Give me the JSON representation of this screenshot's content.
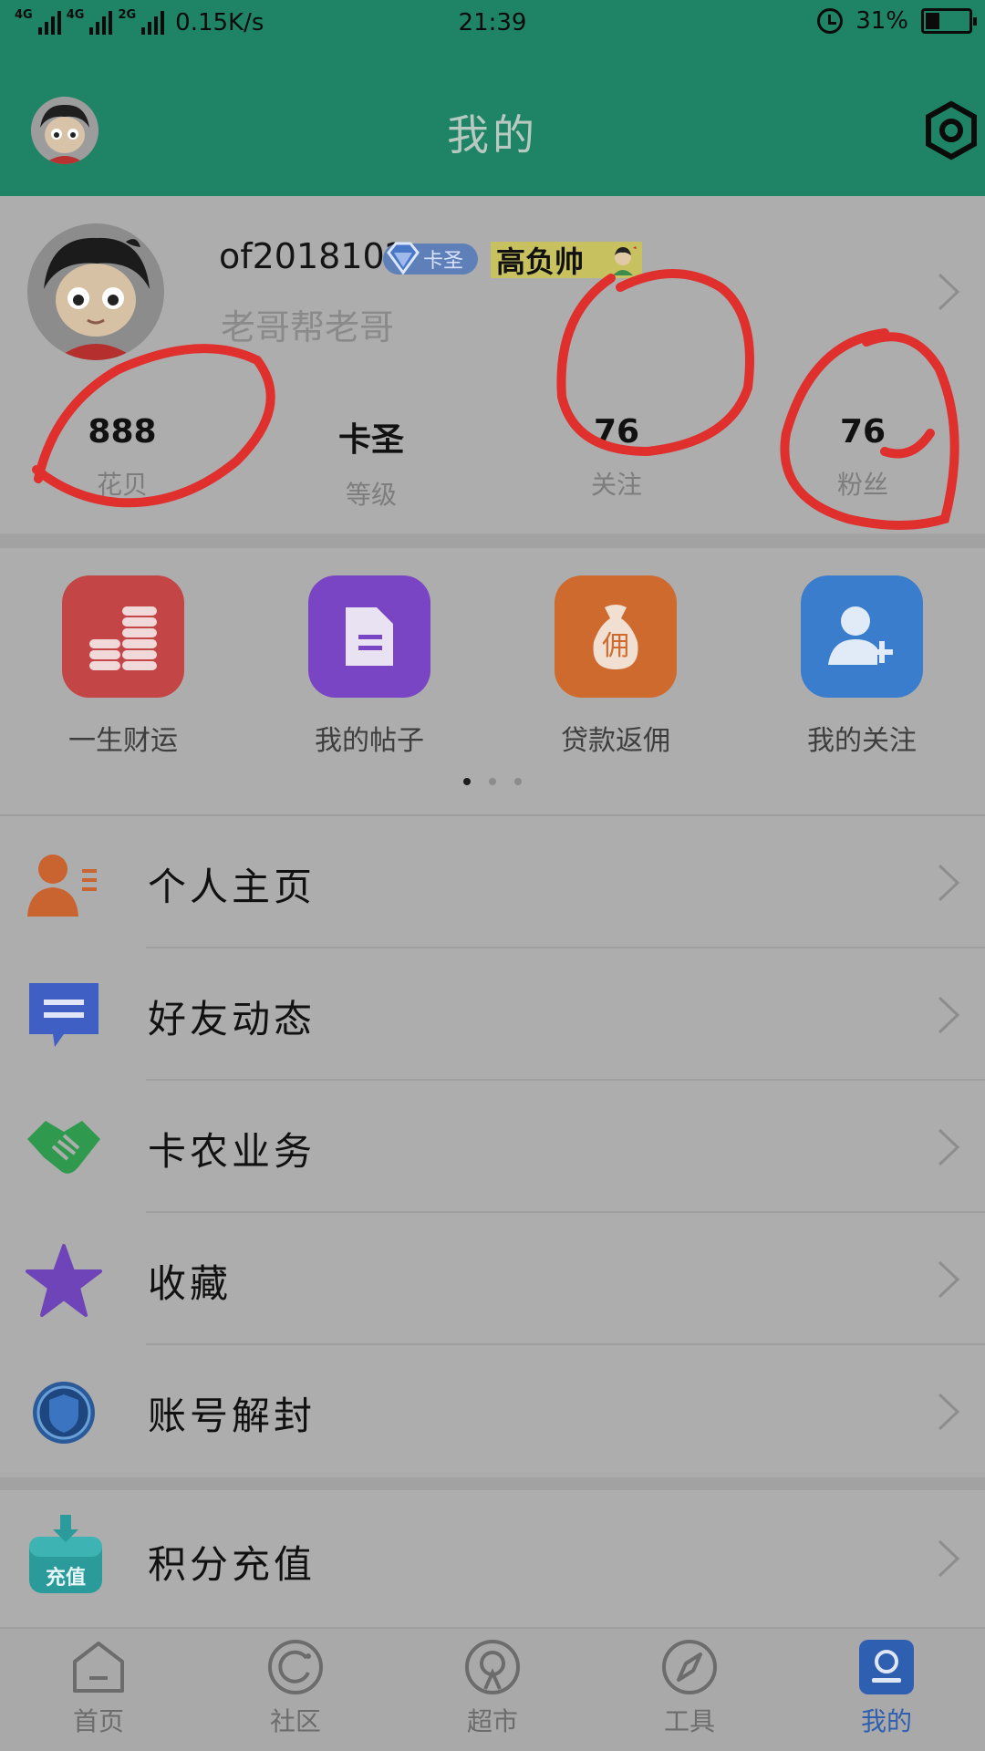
{
  "status_bar": {
    "network_1": "4G",
    "network_2": "4G",
    "network_3": "2G",
    "speed": "0.15K/s",
    "time": "21:39",
    "battery": "31%",
    "battery_level": 0.31
  },
  "header": {
    "title": "我的"
  },
  "profile": {
    "username": "of2018102",
    "vip_label": "卡圣",
    "title_badge": "高负帅",
    "signature": "老哥帮老哥"
  },
  "stats": [
    {
      "value": "888",
      "label": "花贝"
    },
    {
      "value": "卡圣",
      "label": "等级"
    },
    {
      "value": "76",
      "label": "关注"
    },
    {
      "value": "76",
      "label": "粉丝"
    }
  ],
  "grid": {
    "items": [
      {
        "label": "一生财运",
        "icon": "coins-icon",
        "color": "#c94b4b"
      },
      {
        "label": "我的帖子",
        "icon": "document-icon",
        "color": "#7b46c9"
      },
      {
        "label": "贷款返佣",
        "icon": "money-bag-icon",
        "color": "#d06a2f"
      },
      {
        "label": "我的关注",
        "icon": "add-user-icon",
        "color": "#3c7fd0"
      }
    ],
    "page_index": 0,
    "page_count": 3
  },
  "menu": [
    {
      "label": "个人主页",
      "icon": "profile-card-icon"
    },
    {
      "label": "好友动态",
      "icon": "chat-icon"
    },
    {
      "label": "卡农业务",
      "icon": "handshake-icon"
    },
    {
      "label": "收藏",
      "icon": "star-icon"
    },
    {
      "label": "账号解封",
      "icon": "shield-icon"
    }
  ],
  "recharge": {
    "label": "积分充值",
    "icon_text": "充值"
  },
  "bottom_nav": [
    {
      "label": "首页",
      "icon": "home-icon"
    },
    {
      "label": "社区",
      "icon": "community-icon"
    },
    {
      "label": "超市",
      "icon": "market-icon"
    },
    {
      "label": "工具",
      "icon": "compass-icon"
    },
    {
      "label": "我的",
      "icon": "profile-icon",
      "active": true
    }
  ],
  "colors": {
    "header": "#1f8466",
    "active_nav": "#2f5fb0",
    "annotation": "#e0302e"
  }
}
